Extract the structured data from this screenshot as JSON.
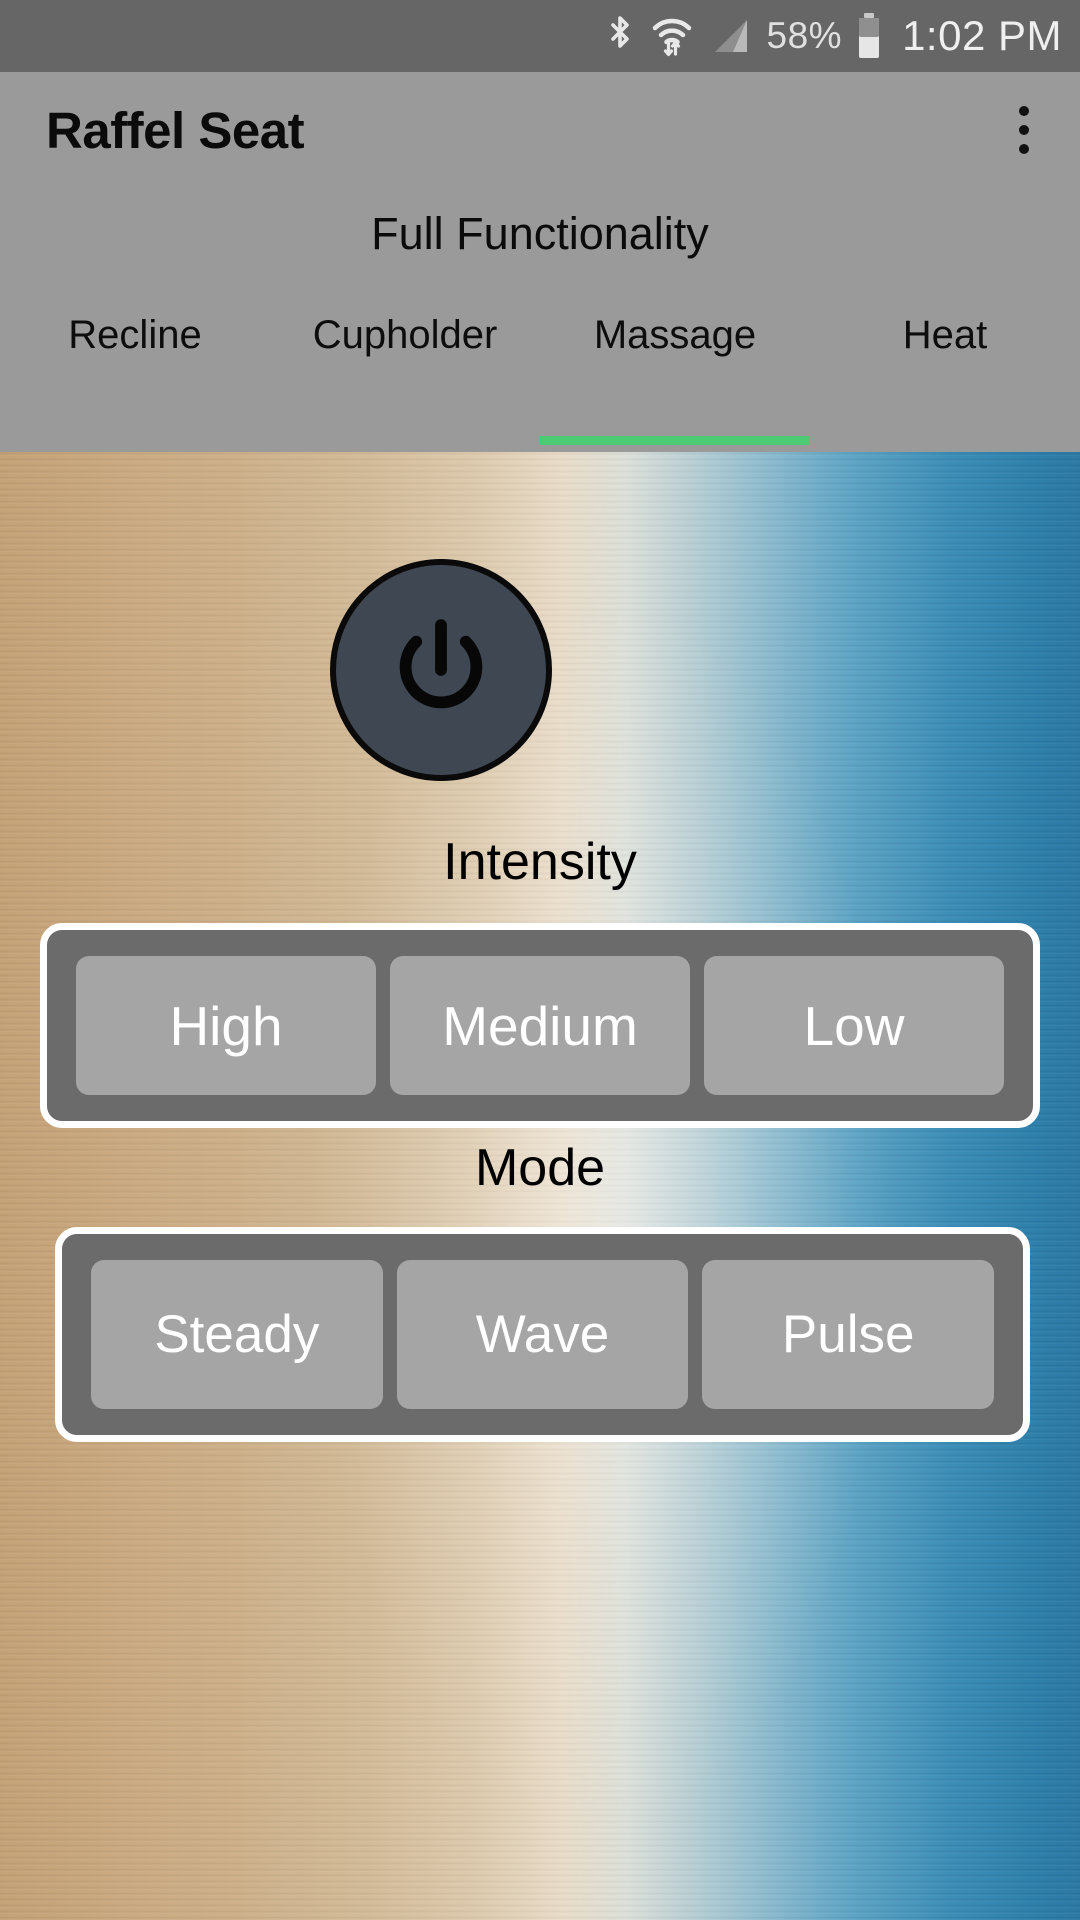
{
  "status_bar": {
    "bluetooth_icon": "bluetooth-icon",
    "wifi_icon": "wifi-icon",
    "signal_icon": "cellular-signal-icon",
    "battery_percent": "58%",
    "battery_icon": "battery-icon",
    "clock": "1:02 PM"
  },
  "app_bar": {
    "title": "Raffel Seat",
    "overflow_icon": "overflow-menu-icon"
  },
  "subtitle": "Full Functionality",
  "tabs": [
    {
      "label": "Recline",
      "active": false
    },
    {
      "label": "Cupholder",
      "active": false
    },
    {
      "label": "Massage",
      "active": true
    },
    {
      "label": "Heat",
      "active": false
    }
  ],
  "main": {
    "power_button": {
      "icon": "power-icon",
      "state": "off"
    },
    "intensity": {
      "label": "Intensity",
      "options": [
        "High",
        "Medium",
        "Low"
      ]
    },
    "mode": {
      "label": "Mode",
      "options": [
        "Steady",
        "Wave",
        "Pulse"
      ]
    }
  },
  "colors": {
    "status_bar_bg": "#666666",
    "header_bg": "#9A9A9A",
    "tab_indicator": "#4CCB72",
    "power_button_fill": "#3E4752",
    "group_frame_border": "#FFFFFF",
    "group_frame_bg": "#6B6B6B",
    "segment_button_bg": "#A5A5A5",
    "segment_button_text": "#FFFFFF",
    "background_left": "#C4A176",
    "background_right": "#2A78A3"
  }
}
